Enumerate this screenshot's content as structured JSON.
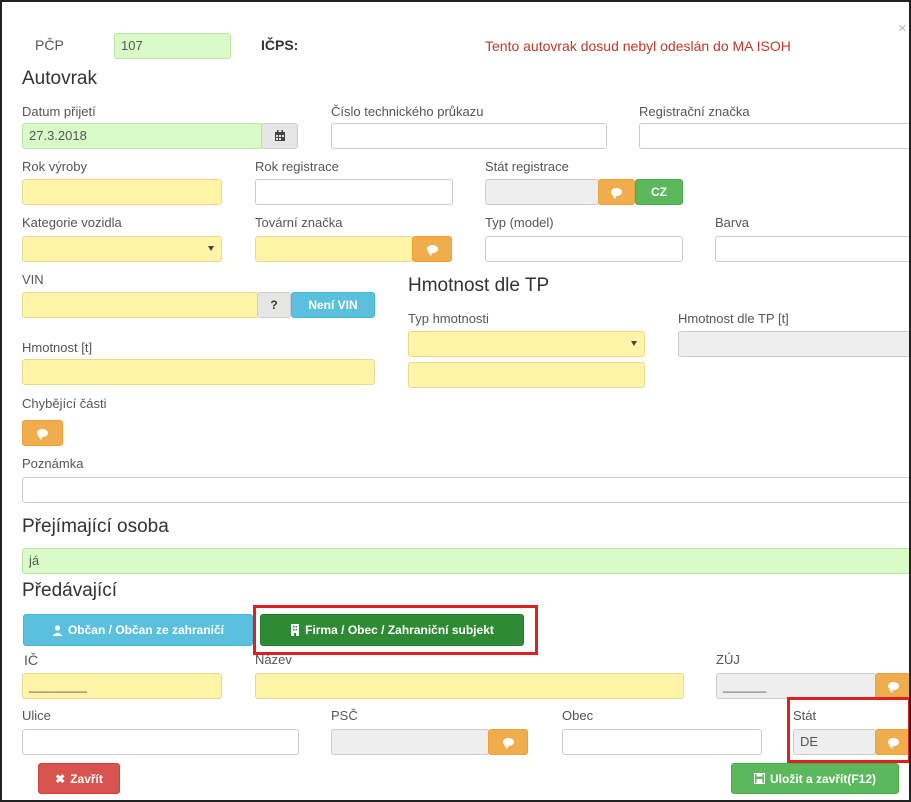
{
  "header": {
    "pcp_label": "PČP",
    "pcp_value": "107",
    "icps_label": "IČPS:",
    "warning": "Tento autovrak dosud nebyl odeslán do MA ISOH",
    "close": "×"
  },
  "autovrak": {
    "title": "Autovrak",
    "datum_prijeti_label": "Datum přijetí",
    "datum_prijeti_value": "27.3.2018",
    "cislo_tp_label": "Číslo technického průkazu",
    "reg_znacka_label": "Registrační značka",
    "rok_vyroby_label": "Rok výroby",
    "rok_registrace_label": "Rok registrace",
    "stat_registrace_label": "Stát registrace",
    "cz_button": "CZ",
    "kategorie_label": "Kategorie vozidla",
    "tovarni_znacka_label": "Tovární značka",
    "typ_model_label": "Typ (model)",
    "barva_label": "Barva",
    "vin_label": "VIN",
    "vin_help": "?",
    "neni_vin_button": "Není VIN",
    "hmotnost_label": "Hmotnost [t]",
    "chybejici_label": "Chybějící části",
    "poznamka_label": "Poznámka"
  },
  "hmotnost_tp": {
    "title": "Hmotnost dle TP",
    "typ_label": "Typ hmotnosti",
    "value_label": "Hmotnost dle TP [t]"
  },
  "prejimajici": {
    "title": "Přejímající osoba",
    "value": "já"
  },
  "predavajici": {
    "title": "Předávající",
    "obcan_button": "Občan / Občan ze zahraničí",
    "firma_button": "Firma / Obec / Zahraniční subjekt",
    "ic_label": "IČ",
    "ic_value": "________",
    "nazev_label": "Název",
    "zuj_label": "ZÚJ",
    "zuj_value": "______",
    "ulice_label": "Ulice",
    "psc_label": "PSČ",
    "obec_label": "Obec",
    "stat_label": "Stát",
    "stat_value": "DE"
  },
  "footer": {
    "zavrit_button": "Zavřít",
    "ulozit_button": "Uložit a zavřít(F12)"
  },
  "colors": {
    "required_yellow": "#fff4a8",
    "filled_green": "#d9fbc8",
    "warning_red": "#c0392b",
    "highlight_red": "#e02020"
  }
}
